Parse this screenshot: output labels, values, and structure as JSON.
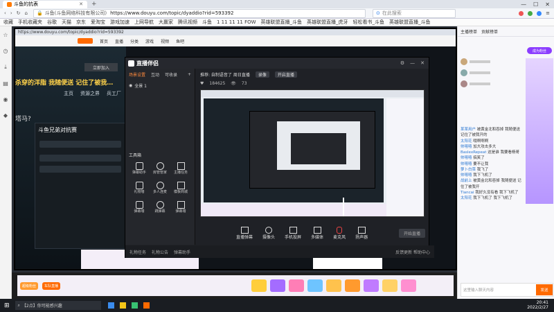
{
  "browser": {
    "tab_title": "斗鱼的抗表",
    "address": "https://www.douyu.com/topic/dyaddio?rid=593392",
    "site_label": "斗鱼(斗鱼网络科技有限公司)",
    "search_placeholder": "在此搜索",
    "bookmarks": [
      "收藏",
      "手机收藏夹",
      "谷歌",
      "天猫",
      "京东",
      "爱淘宝",
      "游戏加速",
      "上网导航",
      "大赢家",
      "腾讯视频",
      "斗鱼",
      "1 11 11 11 FOW",
      "英雄联盟直播_斗鱼",
      "英雄联盟直播_虎牙",
      "轻松看书_斗鱼",
      "英雄联盟直播_斗鱼"
    ]
  },
  "stream": {
    "room_title": "斗鱼兄弟对抗赛",
    "banner_text": "杀穿的洋脂 我随便送 记住了被我…",
    "line2": "塔马?",
    "nav": [
      "主页",
      "资源之界",
      "兵工厂"
    ],
    "outer_nav": [
      "首页",
      "直播",
      "分类",
      "游戏",
      "视频",
      "鱼吧"
    ]
  },
  "zb": {
    "app_name": "直播伴侣",
    "tabs": [
      "场景设置",
      "互动",
      "可收录"
    ],
    "scene_label": "全景 1",
    "status_text": "推荐: 自制语音了 周日直播",
    "rec_label": "录像",
    "stream_label": "开启直播",
    "fans": "184625",
    "viewers": "73",
    "tools_title": "工具箱",
    "tools": [
      "弹幕助手",
      "房管管家",
      "主播任务",
      "礼物墙",
      "多人连麦",
      "模板商城",
      "弹幕墙",
      "跳弹幕",
      "弹幕墙"
    ],
    "bottom_tools": [
      "直播弹幕",
      "摄像头",
      "手机投屏",
      "多媒体",
      "麦克风",
      "扬声器"
    ],
    "start_button": "开始直播",
    "footer_items": [
      "礼物任务",
      "礼物公告",
      "弹幕助手"
    ],
    "footer_right": "反馈更新  帮助中心"
  },
  "chat": {
    "header_tab": "主播榜单",
    "header_tab2": "贡献榜单",
    "follow_button": "成为粉丝",
    "messages": [
      {
        "user": "某某用户",
        "text": "被黄金北和吞掉 我随便送 记住了被我开的"
      },
      {
        "user": "太阳花",
        "text": "哦啊啊啊"
      },
      {
        "user": "帅嘻嘻",
        "text": "加大攻击多大"
      },
      {
        "user": "BaslexRepeat",
        "text": "这是谁 我要看杨哥"
      },
      {
        "user": "帅嘻嘻",
        "text": "搞笑了"
      },
      {
        "user": "帅嘻嘻",
        "text": "要不让我"
      },
      {
        "user": "萝卜白菜",
        "text": "我飞了"
      },
      {
        "user": "帅嘻嘻",
        "text": "我下飞机了"
      },
      {
        "user": "战前上",
        "text": "被黄金北和吞掉 我随便送 记住了被我开"
      },
      {
        "user": "Tiancai",
        "text": "我好久没有看 我下飞机了"
      },
      {
        "user": "太阳花",
        "text": "我下飞机了 我下飞机了"
      }
    ],
    "input_placeholder": "这里输入聊天内容",
    "send_button": "发送"
  },
  "taskbar": {
    "search_text": "【2点】你可能感兴趣",
    "time": "20:41",
    "date": "2022/2/27"
  },
  "badges": [
    "超级粉丝",
    "车队直播"
  ],
  "colors": {
    "accent": "#ff6a00",
    "purple": "#8b3dff",
    "zb_bg": "#1f2126"
  }
}
